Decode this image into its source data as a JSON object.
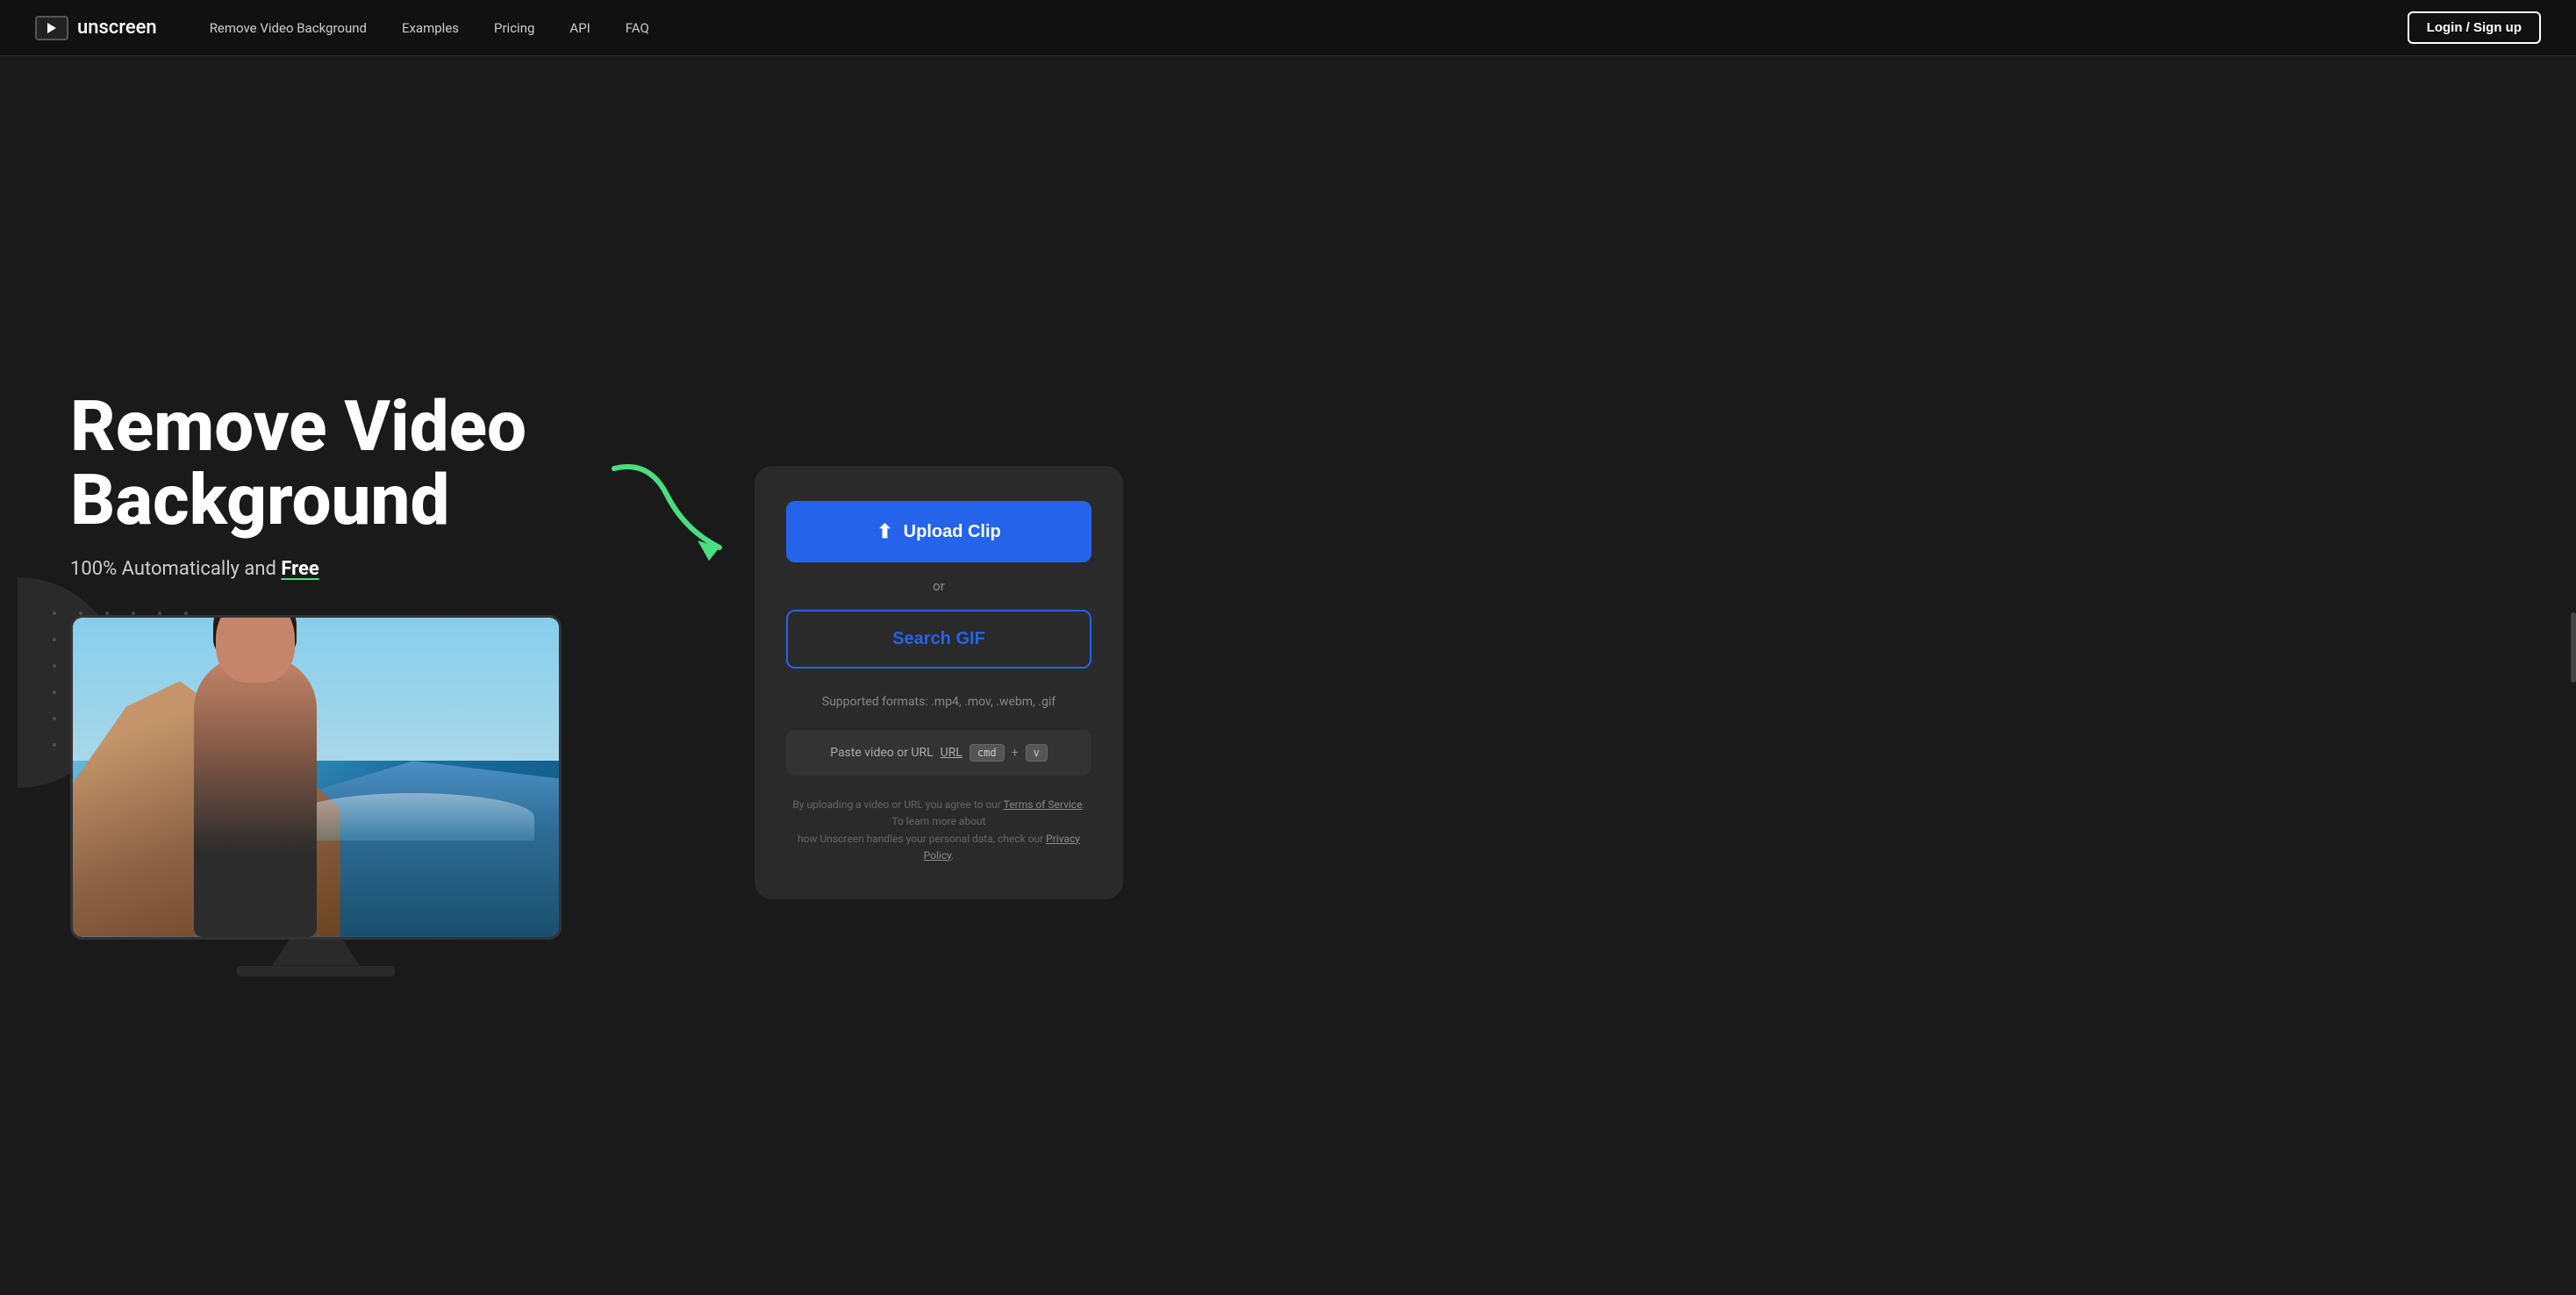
{
  "nav": {
    "logo_text": "unscreen",
    "links": [
      {
        "label": "Remove Video Background",
        "id": "remove-bg"
      },
      {
        "label": "Examples",
        "id": "examples"
      },
      {
        "label": "Pricing",
        "id": "pricing"
      },
      {
        "label": "API",
        "id": "api"
      },
      {
        "label": "FAQ",
        "id": "faq"
      }
    ],
    "login_label": "Login / Sign up"
  },
  "hero": {
    "title_line1": "Remove Video",
    "title_line2": "Background",
    "subtitle_normal": "100% Automatically and ",
    "subtitle_bold": "Free",
    "upload_btn_label": "Upload Clip",
    "or_text": "or",
    "search_gif_label": "Search GIF",
    "supported_formats": "Supported formats: .mp4, .mov, .webm, .gif",
    "paste_label": "Paste video or URL",
    "url_text": "URL",
    "cmd_key": "cmd",
    "v_key": "v",
    "terms_line1": "By uploading a video or URL you agree to our ",
    "terms_link1": "Terms of Service",
    "terms_line2": ". To learn more about",
    "terms_line3": "how Unscreen handles your personal data, check our ",
    "terms_link2": "Privacy Policy",
    "terms_end": "."
  },
  "colors": {
    "background": "#1a1a1a",
    "nav_bg": "#111111",
    "upload_btn": "#2563eb",
    "search_gif_border": "#2563eb",
    "accent_green": "#4ade80",
    "card_bg": "#2a2a2a"
  }
}
